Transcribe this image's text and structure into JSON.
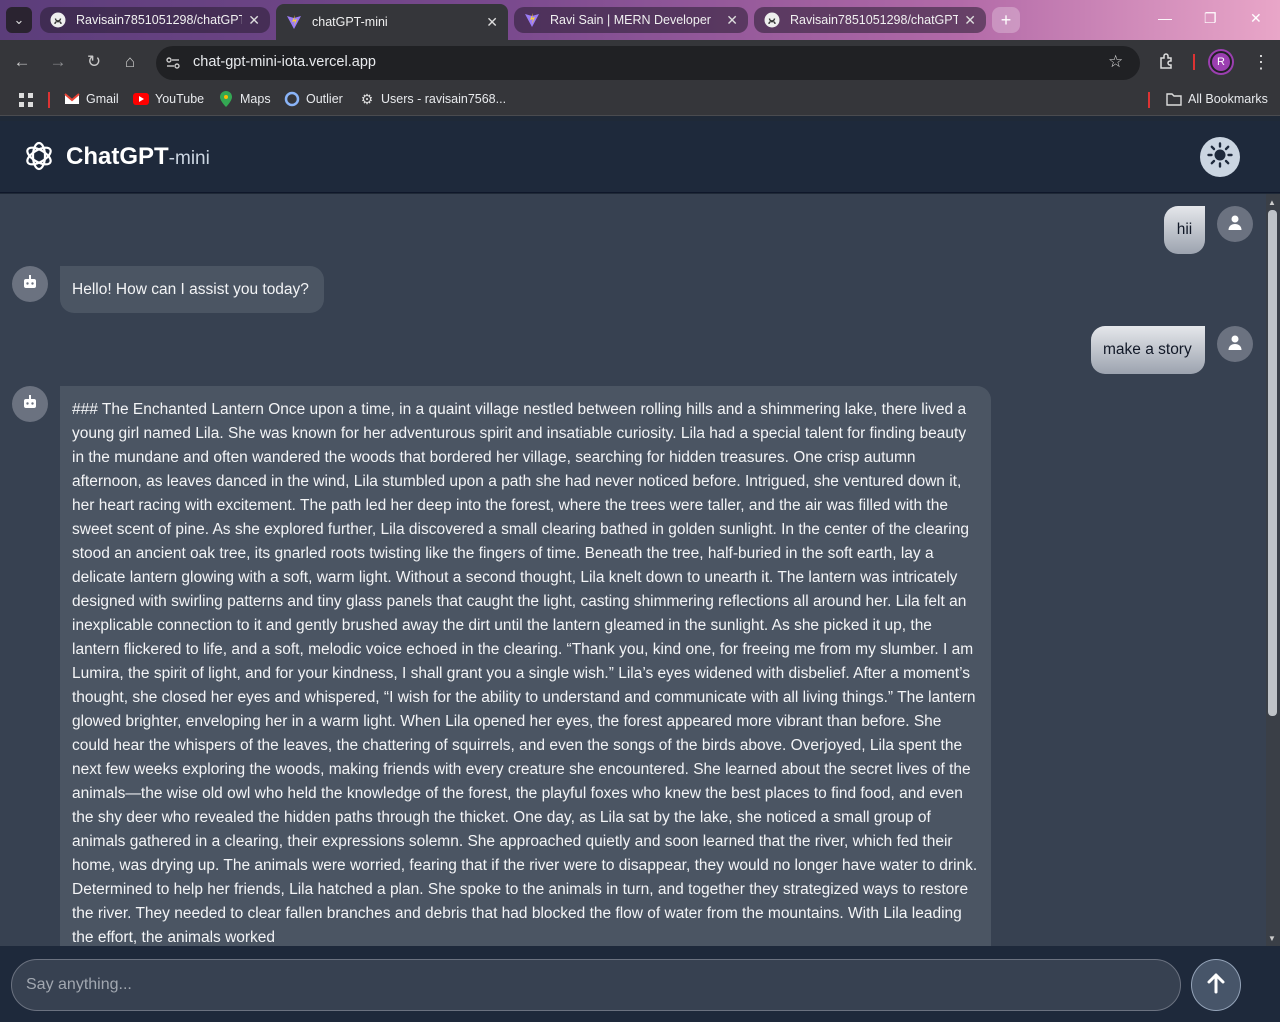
{
  "browser": {
    "tabs": [
      {
        "label": "Ravisain7851051298/chatGPT-m",
        "icon": "github-icon",
        "active": false
      },
      {
        "label": "chatGPT-mini",
        "icon": "vite-icon",
        "active": true
      },
      {
        "label": "Ravi Sain | MERN Developer",
        "icon": "vite-icon",
        "active": false
      },
      {
        "label": "Ravisain7851051298/chatGPT-m",
        "icon": "github-icon",
        "active": false
      }
    ],
    "url": "chat-gpt-mini-iota.vercel.app",
    "profile_initial": "R",
    "bookmarks": [
      {
        "label": "Gmail",
        "icon": "gmail-icon"
      },
      {
        "label": "YouTube",
        "icon": "youtube-icon"
      },
      {
        "label": "Maps",
        "icon": "maps-icon"
      },
      {
        "label": "Outlier",
        "icon": "outlier-icon"
      },
      {
        "label": "Users - ravisain7568...",
        "icon": "gear-icon"
      }
    ],
    "all_bookmarks": "All Bookmarks"
  },
  "app": {
    "brand": "ChatGPT",
    "brand_sub": "-mini",
    "theme_toggle_icon": "sun-icon",
    "colors": {
      "header": "#1e293b",
      "chat_bg": "#374151",
      "bot_bubble": "#4b5563"
    }
  },
  "messages": [
    {
      "role": "user",
      "text": "hii"
    },
    {
      "role": "bot",
      "text": "Hello! How can I assist you today?"
    },
    {
      "role": "user",
      "text": "make a story"
    },
    {
      "role": "bot",
      "text": "### The Enchanted Lantern Once upon a time, in a quaint village nestled between rolling hills and a shimmering lake, there lived a young girl named Lila. She was known for her adventurous spirit and insatiable curiosity. Lila had a special talent for finding beauty in the mundane and often wandered the woods that bordered her village, searching for hidden treasures. One crisp autumn afternoon, as leaves danced in the wind, Lila stumbled upon a path she had never noticed before. Intrigued, she ventured down it, her heart racing with excitement. The path led her deep into the forest, where the trees were taller, and the air was filled with the sweet scent of pine. As she explored further, Lila discovered a small clearing bathed in golden sunlight. In the center of the clearing stood an ancient oak tree, its gnarled roots twisting like the fingers of time. Beneath the tree, half-buried in the soft earth, lay a delicate lantern glowing with a soft, warm light. Without a second thought, Lila knelt down to unearth it. The lantern was intricately designed with swirling patterns and tiny glass panels that caught the light, casting shimmering reflections all around her. Lila felt an inexplicable connection to it and gently brushed away the dirt until the lantern gleamed in the sunlight. As she picked it up, the lantern flickered to life, and a soft, melodic voice echoed in the clearing. “Thank you, kind one, for freeing me from my slumber. I am Lumira, the spirit of light, and for your kindness, I shall grant you a single wish.” Lila’s eyes widened with disbelief. After a moment’s thought, she closed her eyes and whispered, “I wish for the ability to understand and communicate with all living things.” The lantern glowed brighter, enveloping her in a warm light. When Lila opened her eyes, the forest appeared more vibrant than before. She could hear the whispers of the leaves, the chattering of squirrels, and even the songs of the birds above. Overjoyed, Lila spent the next few weeks exploring the woods, making friends with every creature she encountered. She learned about the secret lives of the animals—the wise old owl who held the knowledge of the forest, the playful foxes who knew the best places to find food, and even the shy deer who revealed the hidden paths through the thicket. One day, as Lila sat by the lake, she noticed a small group of animals gathered in a clearing, their expressions solemn. She approached quietly and soon learned that the river, which fed their home, was drying up. The animals were worried, fearing that if the river were to disappear, they would no longer have water to drink. Determined to help her friends, Lila hatched a plan. She spoke to the animals in turn, and together they strategized ways to restore the river. They needed to clear fallen branches and debris that had blocked the flow of water from the mountains. With Lila leading the effort, the animals worked"
    }
  ],
  "composer": {
    "placeholder": "Say anything...",
    "send_icon": "arrow-up-icon"
  }
}
